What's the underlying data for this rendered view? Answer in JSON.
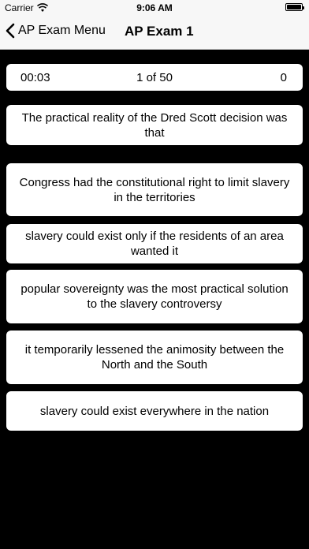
{
  "status_bar": {
    "carrier": "Carrier",
    "time": "9:06 AM",
    "wifi_icon": "wifi-icon",
    "battery_icon": "battery-full-icon"
  },
  "nav": {
    "back_label": "AP Exam Menu",
    "title": "AP Exam 1",
    "back_icon": "chevron-left-icon"
  },
  "quiz": {
    "timer": "00:03",
    "progress": "1 of 50",
    "score": "0",
    "question": "The practical reality of the Dred Scott decision was that",
    "answers": [
      "Congress had the constitutional right to limit slavery in the territories",
      "slavery could exist only if the residents of an area wanted it",
      "popular sovereignty was the most practical solution to the slavery controversy",
      "it temporarily lessened the animosity between the North and the South",
      "slavery could exist everywhere in the nation"
    ]
  },
  "colors": {
    "background": "#000000",
    "card": "#ffffff",
    "navbar": "#f7f7f7"
  }
}
